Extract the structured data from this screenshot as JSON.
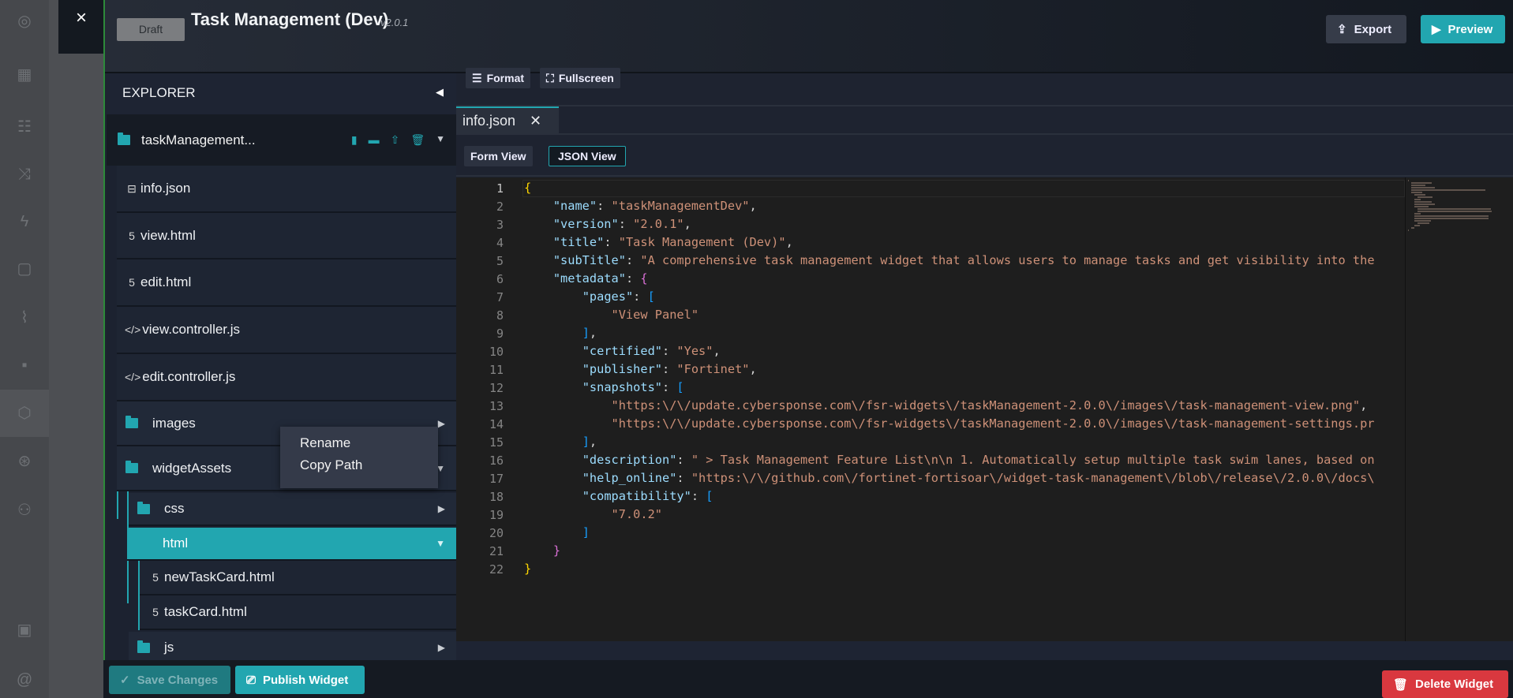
{
  "header": {
    "close_label": "×",
    "status_badge": "Draft",
    "title": "Task Management (Dev)",
    "version": "v2.0.1",
    "export_label": "Export",
    "preview_label": "Preview"
  },
  "explorer": {
    "title": "EXPLORER",
    "root": "taskManagement...",
    "items": [
      {
        "label": "info.json",
        "icon": "json-file-icon",
        "glyph": "⊟"
      },
      {
        "label": "view.html",
        "icon": "html5-icon",
        "glyph": "5"
      },
      {
        "label": "edit.html",
        "icon": "html5-icon",
        "glyph": "5"
      },
      {
        "label": "view.controller.js",
        "icon": "code-icon",
        "glyph": "</>"
      },
      {
        "label": "edit.controller.js",
        "icon": "code-icon",
        "glyph": "</>"
      }
    ],
    "folders": {
      "images": "images",
      "widgetAssets": "widgetAssets",
      "css": "css",
      "html": "html",
      "js": "js"
    },
    "html_files": [
      "newTaskCard.html",
      "taskCard.html"
    ]
  },
  "context_menu": {
    "items": [
      "Rename",
      "Copy Path"
    ]
  },
  "editor": {
    "format_label": "Format",
    "fullscreen_label": "Fullscreen",
    "tab_label": "info.json",
    "form_view_label": "Form View",
    "json_view_label": "JSON View",
    "lines": [
      [
        [
          "b1",
          "{"
        ]
      ],
      [
        [
          "p",
          "    "
        ],
        [
          "k",
          "\"name\""
        ],
        [
          "p",
          ": "
        ],
        [
          "s",
          "\"taskManagementDev\""
        ],
        [
          "p",
          ","
        ]
      ],
      [
        [
          "p",
          "    "
        ],
        [
          "k",
          "\"version\""
        ],
        [
          "p",
          ": "
        ],
        [
          "s",
          "\"2.0.1\""
        ],
        [
          "p",
          ","
        ]
      ],
      [
        [
          "p",
          "    "
        ],
        [
          "k",
          "\"title\""
        ],
        [
          "p",
          ": "
        ],
        [
          "s",
          "\"Task Management (Dev)\""
        ],
        [
          "p",
          ","
        ]
      ],
      [
        [
          "p",
          "    "
        ],
        [
          "k",
          "\"subTitle\""
        ],
        [
          "p",
          ": "
        ],
        [
          "s",
          "\"A comprehensive task management widget that allows users to manage tasks and get visibility into the"
        ]
      ],
      [
        [
          "p",
          "    "
        ],
        [
          "k",
          "\"metadata\""
        ],
        [
          "p",
          ": "
        ],
        [
          "b2",
          "{"
        ]
      ],
      [
        [
          "p",
          "        "
        ],
        [
          "k",
          "\"pages\""
        ],
        [
          "p",
          ": "
        ],
        [
          "b3",
          "["
        ]
      ],
      [
        [
          "p",
          "            "
        ],
        [
          "s",
          "\"View Panel\""
        ]
      ],
      [
        [
          "p",
          "        "
        ],
        [
          "b3",
          "]"
        ],
        [
          "p",
          ","
        ]
      ],
      [
        [
          "p",
          "        "
        ],
        [
          "k",
          "\"certified\""
        ],
        [
          "p",
          ": "
        ],
        [
          "s",
          "\"Yes\""
        ],
        [
          "p",
          ","
        ]
      ],
      [
        [
          "p",
          "        "
        ],
        [
          "k",
          "\"publisher\""
        ],
        [
          "p",
          ": "
        ],
        [
          "s",
          "\"Fortinet\""
        ],
        [
          "p",
          ","
        ]
      ],
      [
        [
          "p",
          "        "
        ],
        [
          "k",
          "\"snapshots\""
        ],
        [
          "p",
          ": "
        ],
        [
          "b3",
          "["
        ]
      ],
      [
        [
          "p",
          "            "
        ],
        [
          "s",
          "\"https:\\/\\/update.cybersponse.com\\/fsr-widgets\\/taskManagement-2.0.0\\/images\\/task-management-view.png\""
        ],
        [
          "p",
          ","
        ]
      ],
      [
        [
          "p",
          "            "
        ],
        [
          "s",
          "\"https:\\/\\/update.cybersponse.com\\/fsr-widgets\\/taskManagement-2.0.0\\/images\\/task-management-settings.pr"
        ]
      ],
      [
        [
          "p",
          "        "
        ],
        [
          "b3",
          "]"
        ],
        [
          "p",
          ","
        ]
      ],
      [
        [
          "p",
          "        "
        ],
        [
          "k",
          "\"description\""
        ],
        [
          "p",
          ": "
        ],
        [
          "s",
          "\" > Task Management Feature List\\n\\n 1. Automatically setup multiple task swim lanes, based on"
        ]
      ],
      [
        [
          "p",
          "        "
        ],
        [
          "k",
          "\"help_online\""
        ],
        [
          "p",
          ": "
        ],
        [
          "s",
          "\"https:\\/\\/github.com\\/fortinet-fortisoar\\/widget-task-management\\/blob\\/release\\/2.0.0\\/docs\\"
        ]
      ],
      [
        [
          "p",
          "        "
        ],
        [
          "k",
          "\"compatibility\""
        ],
        [
          "p",
          ": "
        ],
        [
          "b3",
          "["
        ]
      ],
      [
        [
          "p",
          "            "
        ],
        [
          "s",
          "\"7.0.2\""
        ]
      ],
      [
        [
          "p",
          "        "
        ],
        [
          "b3",
          "]"
        ]
      ],
      [
        [
          "p",
          "    "
        ],
        [
          "b2",
          "}"
        ]
      ],
      [
        [
          "b1",
          "}"
        ]
      ]
    ]
  },
  "footer": {
    "save_label": "Save Changes",
    "publish_label": "Publish Widget",
    "delete_label": "Delete Widget"
  },
  "colors": {
    "accent": "#22a6b0",
    "danger": "#d9383f"
  }
}
